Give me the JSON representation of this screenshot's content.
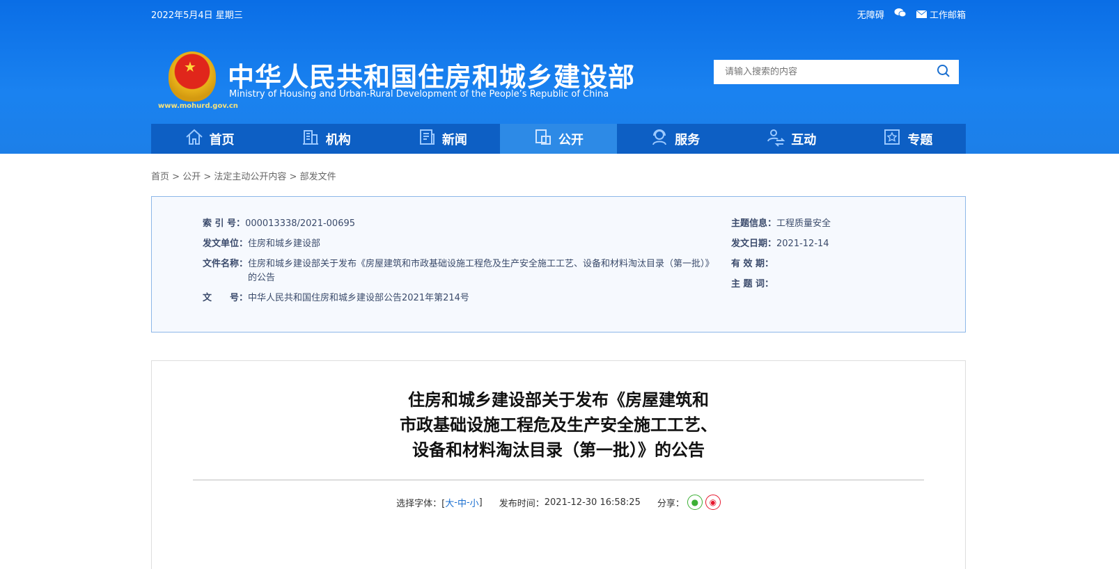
{
  "topbar": {
    "date": "2022年5月4日 星期三",
    "accessibility": "无障碍",
    "mail": "工作邮箱"
  },
  "header": {
    "title_cn": "中华人民共和国住房和城乡建设部",
    "title_en": "Ministry of Housing and Urban-Rural Development of the People’s Republic of China",
    "url": "www.mohurd.gov.cn",
    "search_placeholder": "请输入搜索的内容"
  },
  "nav": [
    {
      "label": "首页"
    },
    {
      "label": "机构"
    },
    {
      "label": "新闻"
    },
    {
      "label": "公开"
    },
    {
      "label": "服务"
    },
    {
      "label": "互动"
    },
    {
      "label": "专题"
    }
  ],
  "breadcrumb": [
    "首页",
    "公开",
    "法定主动公开内容",
    "部发文件"
  ],
  "info": {
    "index_label": "索 引 号：",
    "index": "000013338/2021-00695",
    "unit_label": "发文单位：",
    "unit": "住房和城乡建设部",
    "name_label": "文件名称：",
    "name": "住房和城乡建设部关于发布《房屋建筑和市政基础设施工程危及生产安全施工工艺、设备和材料淘汰目录（第一批）》的公告",
    "docno_label": "文　　号：",
    "docno": "中华人民共和国住房和城乡建设部公告2021年第214号",
    "topic_label": "主题信息：",
    "topic": "工程质量安全",
    "date_label": "发文日期：",
    "date": "2021-12-14",
    "valid_label": "有 效 期：",
    "keywords_label": "主 题 词："
  },
  "article": {
    "title_lines": [
      "住房和城乡建设部关于发布《房屋建筑和",
      "市政基础设施工程危及生产安全施工工艺、",
      "设备和材料淘汰目录（第一批）》的公告"
    ],
    "font_label": "选择字体：[",
    "font_large": "大",
    "font_mid": "中",
    "font_small": "小",
    "sep": " - ",
    "font_end": "]",
    "publish_label": "发布时间：",
    "publish_time": "2021-12-30 16:58:25",
    "share_label": "分享："
  }
}
